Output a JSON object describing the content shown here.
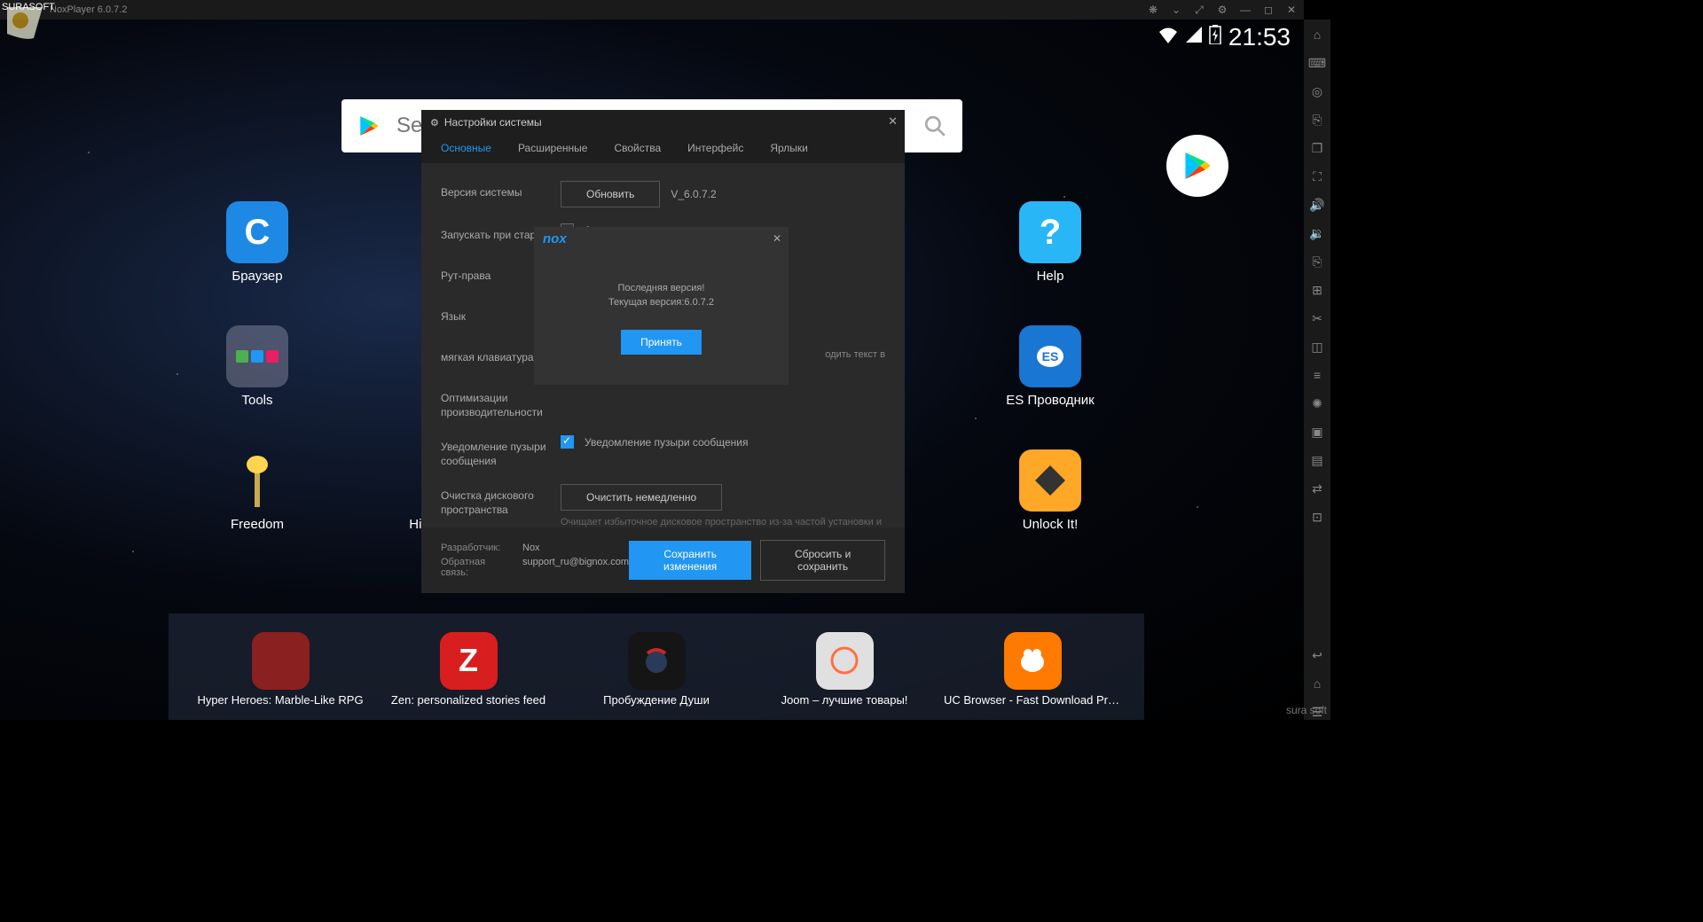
{
  "watermark": {
    "topleft": "SURASOFT",
    "bottomright": "sura soft"
  },
  "titlebar": {
    "title": "NoxPlayer 6.0.7.2"
  },
  "status": {
    "time": "21:53"
  },
  "search": {
    "placeholder": "Search Game, App"
  },
  "apps": {
    "browser": "Браузер",
    "tools": "Tools",
    "freedom": "Freedom",
    "hil": "Hil",
    "help": "Help",
    "es": "ES Проводник",
    "unlock": "Unlock It!"
  },
  "dock": [
    {
      "label": "Hyper Heroes: Marble-Like RPG",
      "bg": "#8a2020"
    },
    {
      "label": "Zen: personalized stories feed",
      "bg": "#d81e1e"
    },
    {
      "label": "Пробуждение Души",
      "bg": "#151515"
    },
    {
      "label": "Joom – лучшие товары!",
      "bg": "#e0e0e0"
    },
    {
      "label": "UC Browser - Fast Download Private",
      "bg": "#ff7a00"
    }
  ],
  "settings": {
    "title": "Настройки системы",
    "tabs": [
      "Основные",
      "Расширенные",
      "Свойства",
      "Интерфейс",
      "Ярлыки"
    ],
    "rows": {
      "version_label": "Версия системы",
      "update_btn": "Обновить",
      "version_value": "V_6.0.7.2",
      "launch_label": "Запускать при старте",
      "launch_check": "Запускать при старте",
      "root_label": "Рут-права",
      "lang_label": "Язык",
      "softkb_label": "мягкая клавиатура",
      "softkb_hint_partial": "одить текст в",
      "perf_label": "Оптимизации производительности",
      "bubble_label": "Уведомление пузыри сообщения",
      "bubble_check": "Уведомление пузыри сообщения",
      "disk_label": "Очистка дискового пространства",
      "disk_btn": "Очистить немедленно",
      "disk_hint": "Очищает избыточное дисковое пространство из-за частой установки и удаления приложений в Nox. Не прерывайте во время процесса очистки, чтобы избежать ошибок."
    },
    "footer": {
      "dev_label": "Разработчик:",
      "dev_value": "Nox",
      "fb_label": "Обратная связь:",
      "fb_value": "support_ru@bignox.com",
      "save": "Сохранить изменения",
      "reset": "Сбросить и сохранить"
    }
  },
  "update": {
    "logo": "nox",
    "line1": "Последняя версия!",
    "line2": "Текущая версия:6.0.7.2",
    "btn": "Принять"
  }
}
